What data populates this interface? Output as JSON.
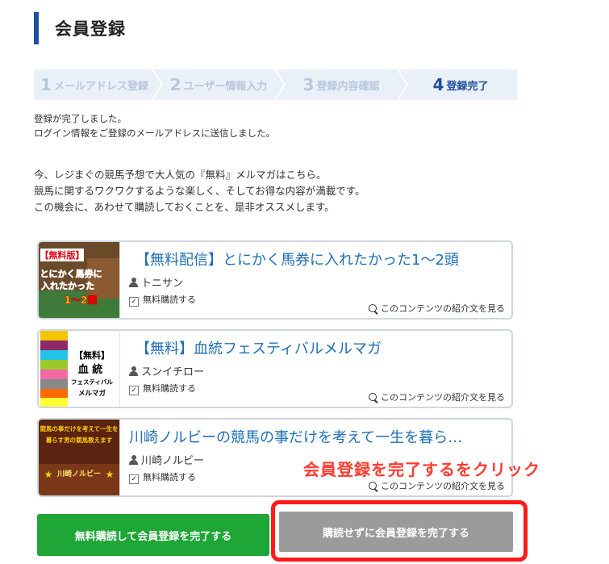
{
  "header": {
    "title": "会員登録"
  },
  "steps": [
    {
      "num": "1",
      "label": "メールアドレス登録"
    },
    {
      "num": "2",
      "label": "ユーザー情報入力"
    },
    {
      "num": "3",
      "label": "登録内容確認"
    },
    {
      "num": "4",
      "label": "登録完了"
    }
  ],
  "completion": {
    "line1": "登録が完了しました。",
    "line2": "ログイン情報をご登録のメールアドレスに送信しました。"
  },
  "promo": {
    "line1": "今、レジまぐの競馬予想で大人気の『無料』メルマガはこちら。",
    "line2": "競馬に関するワクワクするような楽しく、そしてお得な内容が満載です。",
    "line3": "この機会に、あわせて購読しておくことを、是非オススメします。"
  },
  "cards": [
    {
      "title": "【無料配信】とにかく馬券に入れたかった1〜2頭",
      "author": "トニサン",
      "checkbox_label": "無料購読する",
      "intro_link": "このコンテンツの紹介文を見る",
      "thumb_text": [
        "【無料版】",
        "とにかく馬券に",
        "入れたかった",
        "1〜2頭"
      ]
    },
    {
      "title": "【無料】血統フェスティバルメルマガ",
      "author": "スンイチロー",
      "checkbox_label": "無料購読する",
      "intro_link": "このコンテンツの紹介文を見る",
      "thumb_text": [
        "【無料】",
        "血 統",
        "フェスティバル",
        "メルマガ"
      ]
    },
    {
      "title": "川崎ノルビーの競馬の事だけを考えて一生を暮ら…",
      "author": "川崎ノルビー",
      "checkbox_label": "無料購読する",
      "intro_link": "このコンテンツの紹介文を見る",
      "thumb_text": [
        "競馬の事だけを考えて一生を",
        "暮らす男の競馬教えます",
        "川崎ノルビー"
      ]
    }
  ],
  "annotation": "会員登録を完了するをクリック",
  "buttons": {
    "subscribe_complete": "無料購読して会員登録を完了する",
    "complete_only": "購読せずに会員登録を完了する"
  },
  "colors": {
    "brand_blue": "#1e4fa0",
    "link_blue": "#1e6fb8",
    "green": "#1ea636",
    "gray": "#9b9b9b",
    "annotation_red": "#ff1a1a"
  }
}
